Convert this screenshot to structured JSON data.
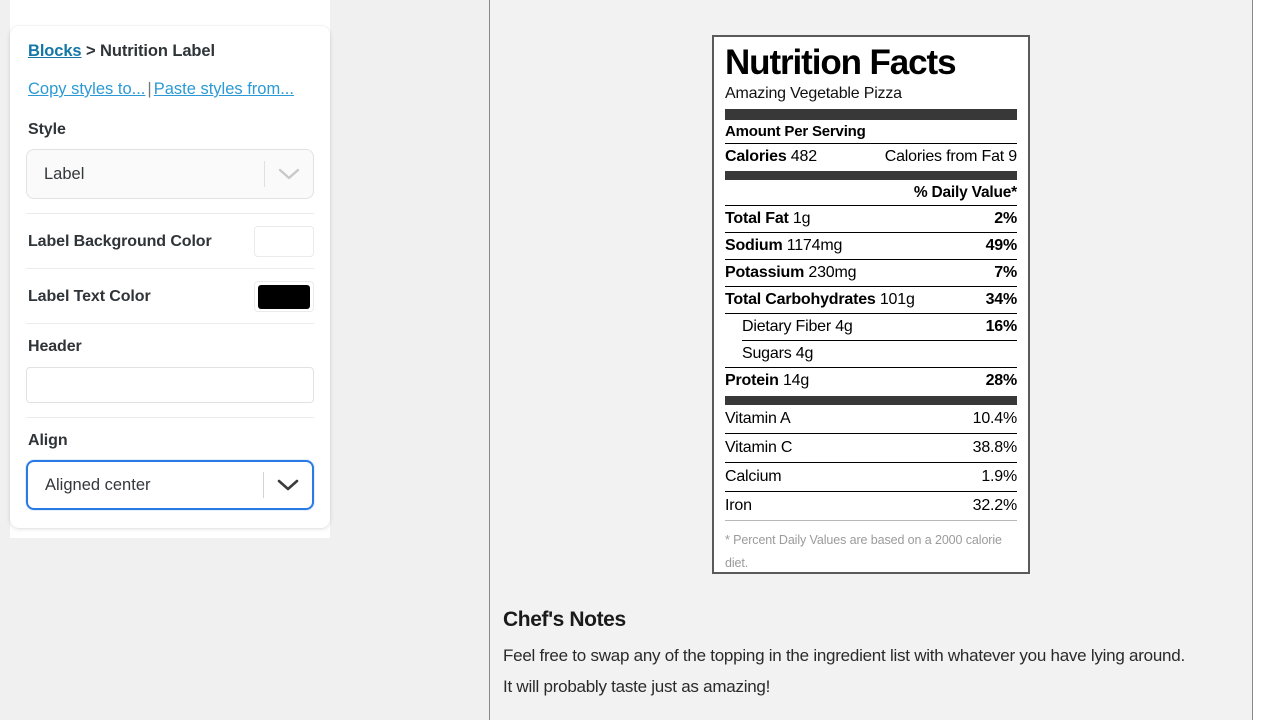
{
  "sidebar": {
    "breadcrumb": {
      "root_label": "Blocks",
      "separator": ">",
      "current_label": "Nutrition Label"
    },
    "style_actions": {
      "copy_label": "Copy styles to...",
      "separator": "|",
      "paste_label": "Paste styles from..."
    },
    "fields": {
      "style": {
        "label": "Style",
        "value": "Label",
        "chevron_icon": "chevron-down-icon"
      },
      "label_background_color": {
        "label": "Label Background Color",
        "color": "#ffffff"
      },
      "label_text_color": {
        "label": "Label Text Color",
        "color": "#000000"
      },
      "header": {
        "label": "Header",
        "value": "",
        "placeholder": ""
      },
      "align": {
        "label": "Align",
        "value": "Aligned center",
        "chevron_icon": "chevron-down-icon",
        "focus_color": "#2a7ae4"
      }
    }
  },
  "nutrition_label": {
    "title": "Nutrition Facts",
    "subtitle": "Amazing Vegetable Pizza",
    "amount_per_serving": "Amount Per Serving",
    "calories_label": "Calories",
    "calories_value": "482",
    "calories_from_fat": "Calories from Fat 9",
    "daily_value_header": "% Daily Value*",
    "rows": [
      {
        "name": "Total Fat",
        "amount": "1g",
        "pct": "2%",
        "bold_name": true,
        "indent": false
      },
      {
        "name": "Sodium",
        "amount": "1174mg",
        "pct": "49%",
        "bold_name": true,
        "indent": false
      },
      {
        "name": "Potassium",
        "amount": "230mg",
        "pct": "7%",
        "bold_name": true,
        "indent": false
      },
      {
        "name": "Total Carbohydrates",
        "amount": "101g",
        "pct": "34%",
        "bold_name": true,
        "indent": false
      },
      {
        "name": "Dietary Fiber",
        "amount": "4g",
        "pct": "16%",
        "bold_name": false,
        "indent": true
      },
      {
        "name": "Sugars",
        "amount": "4g",
        "pct": "",
        "bold_name": false,
        "indent": true
      },
      {
        "name": "Protein",
        "amount": "14g",
        "pct": "28%",
        "bold_name": true,
        "indent": false
      }
    ],
    "vitamins": [
      {
        "name": "Vitamin A",
        "pct": "10.4%"
      },
      {
        "name": "Vitamin C",
        "pct": "38.8%"
      },
      {
        "name": "Calcium",
        "pct": "1.9%"
      },
      {
        "name": "Iron",
        "pct": "32.2%"
      }
    ],
    "footnote": "* Percent Daily Values are based on a 2000 calorie diet."
  },
  "chef_notes": {
    "title": "Chef's Notes",
    "body": "Feel free to swap any of the topping in the ingredient list with whatever you have lying around. It will probably taste just as amazing!"
  }
}
